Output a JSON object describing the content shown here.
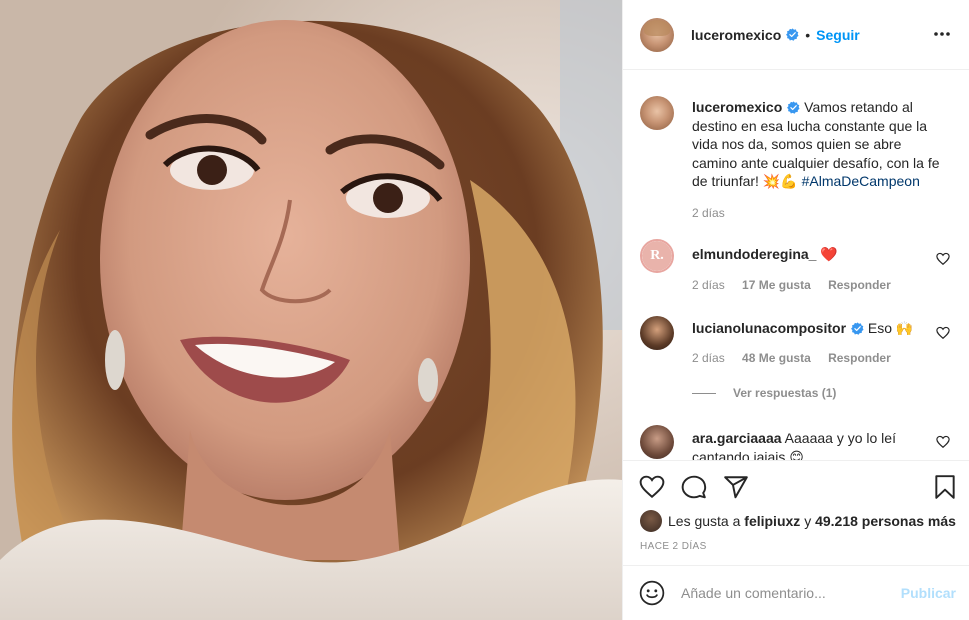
{
  "post": {
    "username": "luceromexico",
    "follow_label": "Seguir",
    "separator": "•"
  },
  "caption": {
    "username": "luceromexico",
    "text": "Vamos retando al destino en esa lucha constante que la vida nos da, somos quien se abre camino ante cualquier desafío, con la fe de triunfar! 💥💪",
    "hashtag": "#AlmaDeCampeon",
    "time": "2 días"
  },
  "comments": [
    {
      "username": "elmundoderegina_",
      "text": "❤️",
      "time": "2 días",
      "likes": "17 Me gusta",
      "reply": "Responder",
      "avatar_letter": "R."
    },
    {
      "username": "lucianolunacompositor",
      "text": "Eso 🙌",
      "time": "2 días",
      "likes": "48 Me gusta",
      "reply": "Responder"
    },
    {
      "username": "ara.garciaaaa",
      "text": "Aaaaaa y yo lo leí cantando jajajs 😊"
    }
  ],
  "view_replies": "Ver respuestas (1)",
  "likes": {
    "prefix": "Les gusta a",
    "user": "felipiuxz",
    "joiner": "y",
    "count": "49.218 personas más"
  },
  "timestamp": "HACE 2 DÍAS",
  "add_comment": {
    "placeholder": "Añade un comentario...",
    "publish_label": "Publicar"
  },
  "colors": {
    "link": "#0095f6",
    "hashtag": "#00376b",
    "muted": "#8e8e8e",
    "verified": "#3897f0",
    "heart": "#ed4956",
    "publish_disabled": "#b2dffc"
  },
  "icons": [
    "verified-badge-icon",
    "more-options-icon",
    "heart-icon",
    "comment-icon",
    "share-icon",
    "bookmark-icon",
    "emoji-icon"
  ]
}
